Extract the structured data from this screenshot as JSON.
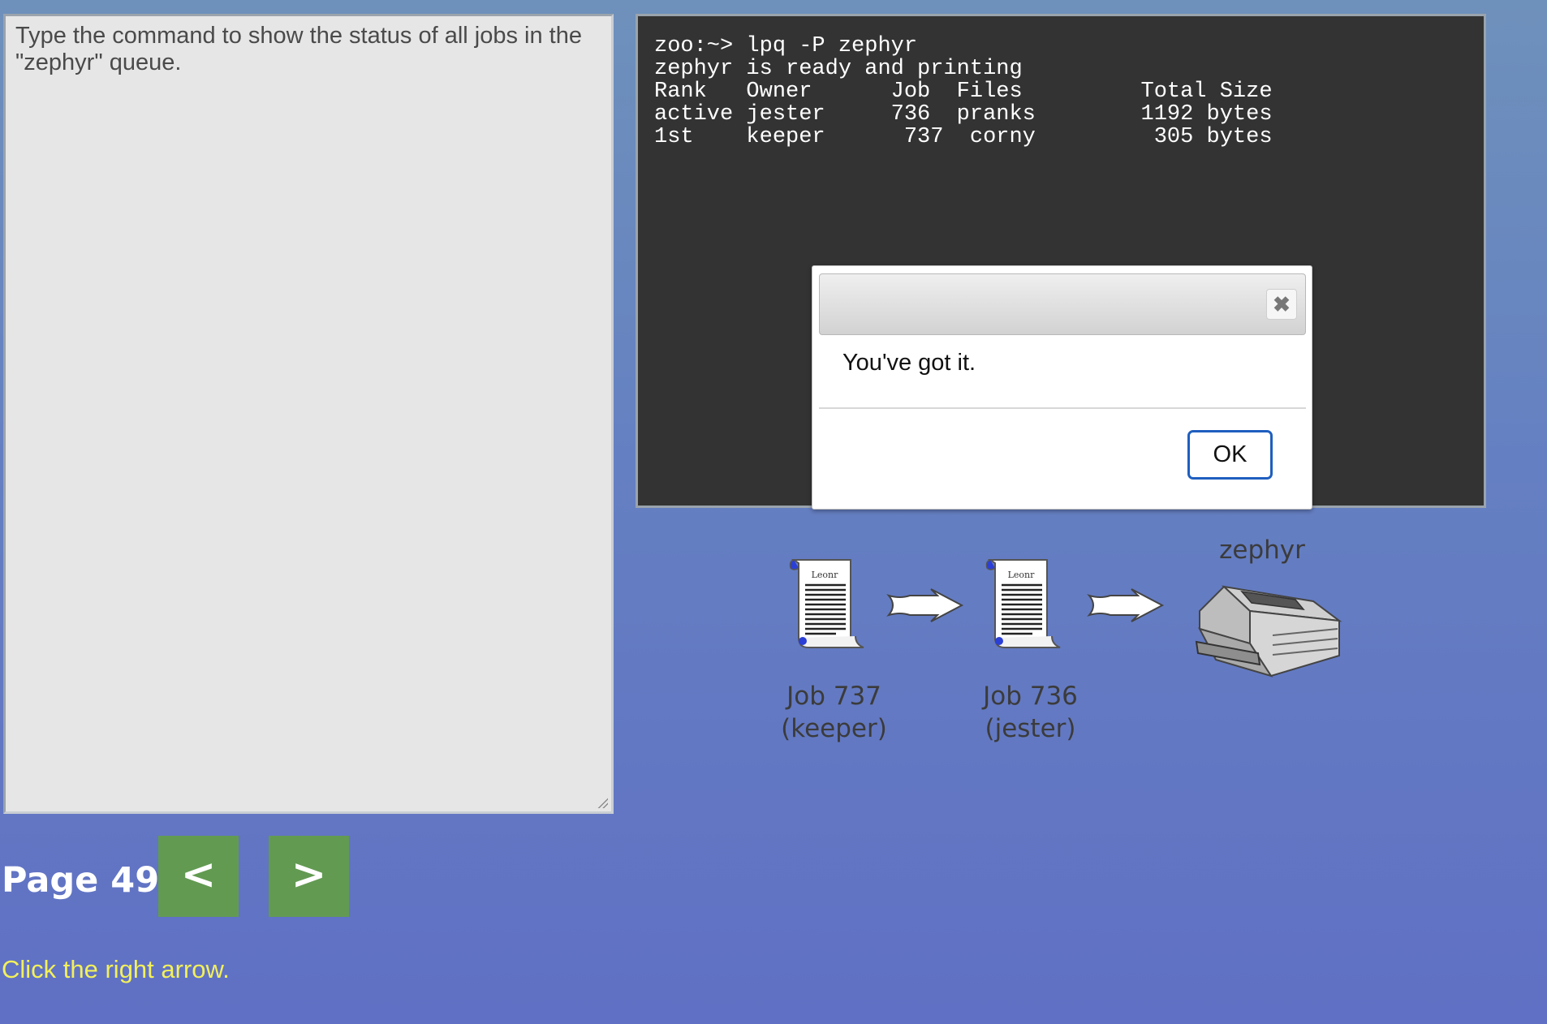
{
  "instructions": {
    "text": "Type the command to show the status of all jobs in the \"zephyr\" queue."
  },
  "terminal": {
    "lines": [
      "zoo:~> lpq -P zephyr",
      "zephyr is ready and printing",
      "Rank   Owner      Job  Files         Total Size",
      "active jester     736  pranks        1192 bytes",
      "1st    keeper      737  corny         305 bytes"
    ]
  },
  "dialog": {
    "title": "",
    "close_icon": "close-icon",
    "message": "You've got it.",
    "ok_label": "OK"
  },
  "diagram": {
    "printer_label": "zephyr",
    "document_header": "Leonr",
    "jobs": [
      {
        "line1": "Job 737",
        "line2": "(keeper)"
      },
      {
        "line1": "Job 736",
        "line2": "(jester)"
      }
    ]
  },
  "nav": {
    "page_label": "Page 49",
    "prev_label": "<",
    "next_label": ">"
  },
  "hint": {
    "text": "Click the right arrow."
  }
}
